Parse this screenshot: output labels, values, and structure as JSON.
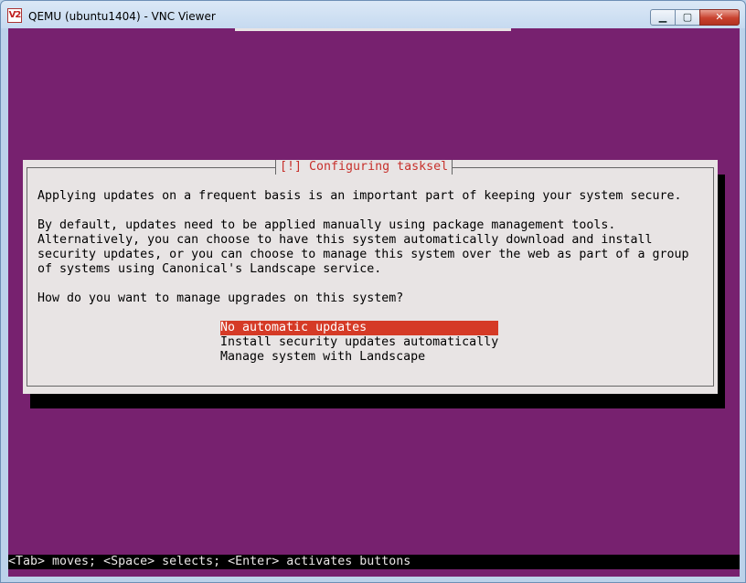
{
  "window": {
    "title": "QEMU (ubuntu1404) - VNC Viewer",
    "app_icon": "V2",
    "buttons": {
      "minimize": "▁",
      "maximize": "▢",
      "close": "✕"
    }
  },
  "dialog": {
    "title": "[!] Configuring tasksel",
    "paragraph1": "Applying updates on a frequent basis is an important part of keeping your system secure.",
    "paragraph2": [
      "By default, updates need to be applied manually using package management tools.",
      "Alternatively, you can choose to have this system automatically download and install",
      "security updates, or you can choose to manage this system over the web as part of a group",
      "of systems using Canonical's Landscape service."
    ],
    "question": "How do you want to manage upgrades on this system?",
    "options": [
      "No automatic updates",
      "Install security updates automatically",
      "Manage system with Landscape"
    ]
  },
  "status_bar": "<Tab> moves; <Space> selects; <Enter> activates buttons",
  "colors": {
    "background": "#77216f",
    "dialog": "#e8e4e4",
    "title_text": "#c7312c",
    "selection": "#d53a26",
    "shadow": "#000000"
  },
  "icons": {
    "app": "vnc-viewer-icon",
    "minimize": "minimize-icon",
    "maximize": "maximize-icon",
    "close": "close-icon"
  }
}
